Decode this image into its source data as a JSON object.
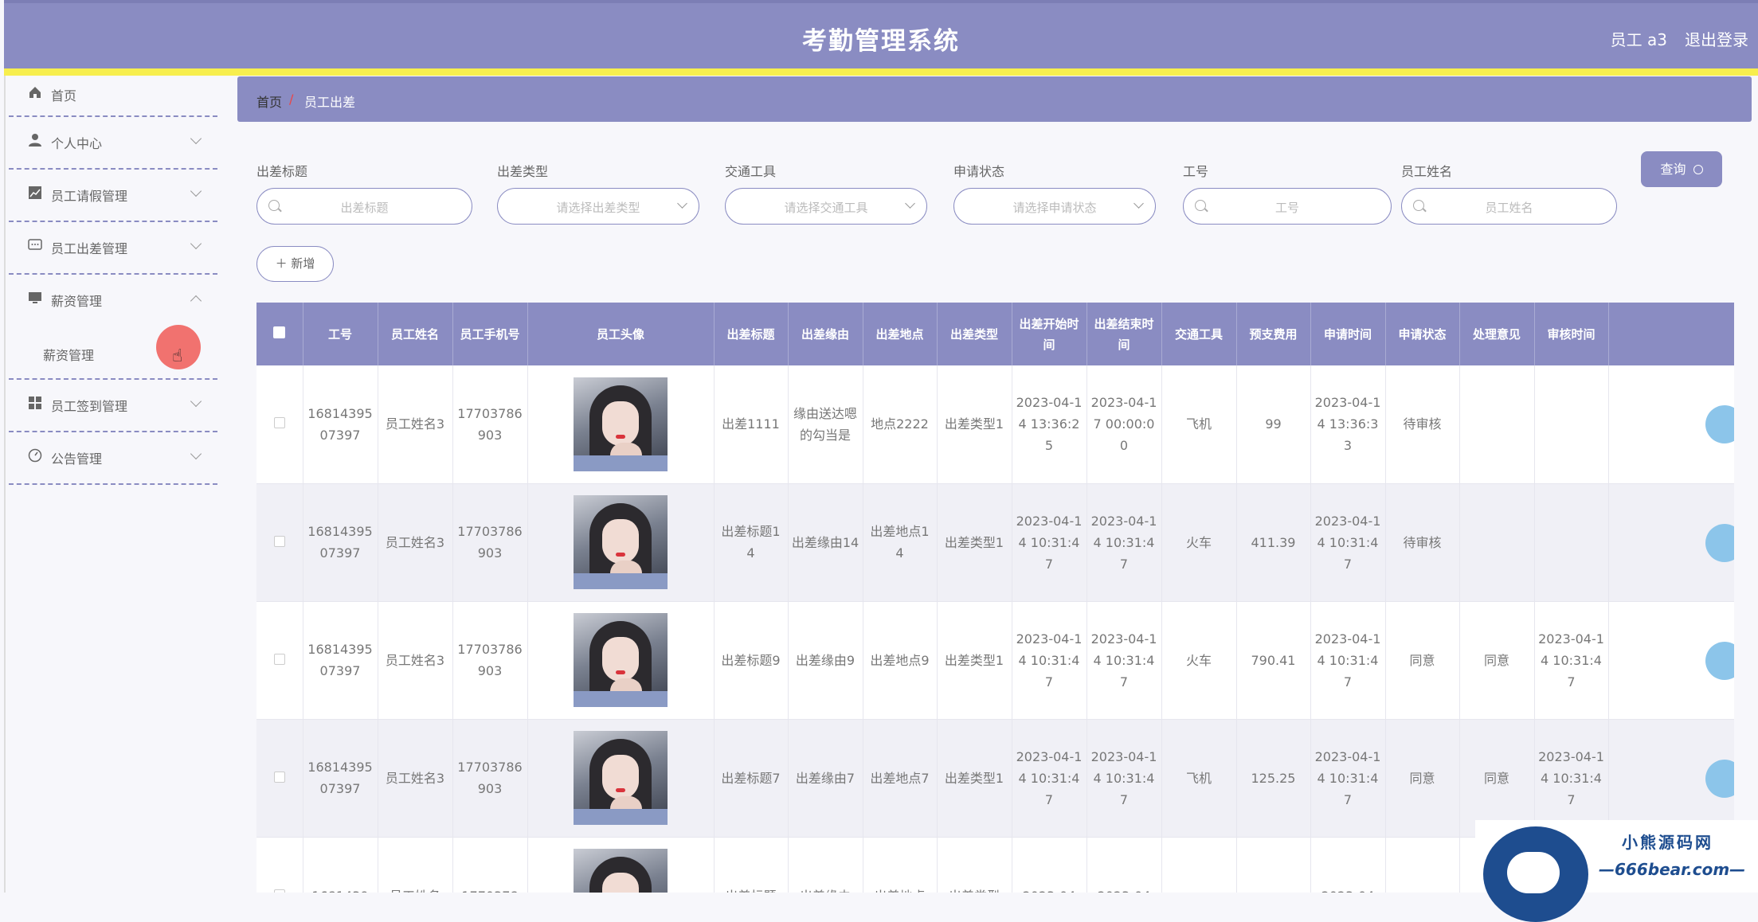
{
  "header": {
    "title": "考勤管理系统",
    "user": "员工 a3",
    "logout": "退出登录"
  },
  "sidebar": {
    "items": [
      {
        "label": "首页",
        "icon": "home-icon"
      },
      {
        "label": "个人中心",
        "icon": "user-icon"
      },
      {
        "label": "员工请假管理",
        "icon": "chart-icon"
      },
      {
        "label": "员工出差管理",
        "icon": "chat-icon"
      },
      {
        "label": "薪资管理",
        "icon": "monitor-icon"
      },
      {
        "label": "员工签到管理",
        "icon": "grid-icon"
      },
      {
        "label": "公告管理",
        "icon": "dashboard-icon"
      }
    ],
    "submenu": {
      "label": "薪资管理"
    }
  },
  "breadcrumb": {
    "home": "首页",
    "sep": "/",
    "current": "员工出差"
  },
  "filters": {
    "title_label": "出差标题",
    "title_placeholder": "出差标题",
    "type_label": "出差类型",
    "type_placeholder": "请选择出差类型",
    "transport_label": "交通工具",
    "transport_placeholder": "请选择交通工具",
    "status_label": "申请状态",
    "status_placeholder": "请选择申请状态",
    "id_label": "工号",
    "id_placeholder": "工号",
    "name_label": "员工姓名",
    "name_placeholder": "员工姓名",
    "query_button": "查询",
    "add_button": "新增"
  },
  "table": {
    "headers": [
      "工号",
      "员工姓名",
      "员工手机号",
      "员工头像",
      "出差标题",
      "出差缘由",
      "出差地点",
      "出差类型",
      "出差开始时间",
      "出差结束时间",
      "交通工具",
      "预支费用",
      "申请时间",
      "申请状态",
      "处理意见",
      "审核时间"
    ],
    "rows": [
      {
        "id": "1681439507397",
        "name": "员工姓名3",
        "phone": "17703786903",
        "title": "出差1111",
        "reason": "缘由送达嗯的勾当是",
        "place": "地点2222",
        "type": "出差类型1",
        "start": "2023-04-14 13:36:25",
        "end": "2023-04-17 00:00:00",
        "transport": "飞机",
        "fee": "99",
        "apply": "2023-04-14 13:36:33",
        "status": "待审核",
        "opinion": "",
        "review": ""
      },
      {
        "id": "1681439507397",
        "name": "员工姓名3",
        "phone": "17703786903",
        "title": "出差标题14",
        "reason": "出差缘由14",
        "place": "出差地点14",
        "type": "出差类型1",
        "start": "2023-04-14 10:31:47",
        "end": "2023-04-14 10:31:47",
        "transport": "火车",
        "fee": "411.39",
        "apply": "2023-04-14 10:31:47",
        "status": "待审核",
        "opinion": "",
        "review": ""
      },
      {
        "id": "1681439507397",
        "name": "员工姓名3",
        "phone": "17703786903",
        "title": "出差标题9",
        "reason": "出差缘由9",
        "place": "出差地点9",
        "type": "出差类型1",
        "start": "2023-04-14 10:31:47",
        "end": "2023-04-14 10:31:47",
        "transport": "火车",
        "fee": "790.41",
        "apply": "2023-04-14 10:31:47",
        "status": "同意",
        "opinion": "同意",
        "review": "2023-04-14 10:31:47"
      },
      {
        "id": "1681439507397",
        "name": "员工姓名3",
        "phone": "17703786903",
        "title": "出差标题7",
        "reason": "出差缘由7",
        "place": "出差地点7",
        "type": "出差类型1",
        "start": "2023-04-14 10:31:47",
        "end": "2023-04-14 10:31:47",
        "transport": "飞机",
        "fee": "125.25",
        "apply": "2023-04-14 10:31:47",
        "status": "同意",
        "opinion": "同意",
        "review": "2023-04-14 10:31:47"
      },
      {
        "id": "1681439",
        "name": "员工姓名",
        "phone": "1770378",
        "title": "出差标题",
        "reason": "出差缘由",
        "place": "出差地点",
        "type": "出差类型",
        "start": "2023-04",
        "end": "2023-04",
        "transport": "",
        "fee": "",
        "apply": "2023-04",
        "status": "",
        "opinion": "",
        "review": ""
      }
    ]
  },
  "watermark": {
    "title": "小熊源码网",
    "url": "—666bear.com—"
  },
  "colors": {
    "primary": "#8a8cc2",
    "accent_bar": "#f7ee4e",
    "row_button": "#8cc5ea"
  }
}
